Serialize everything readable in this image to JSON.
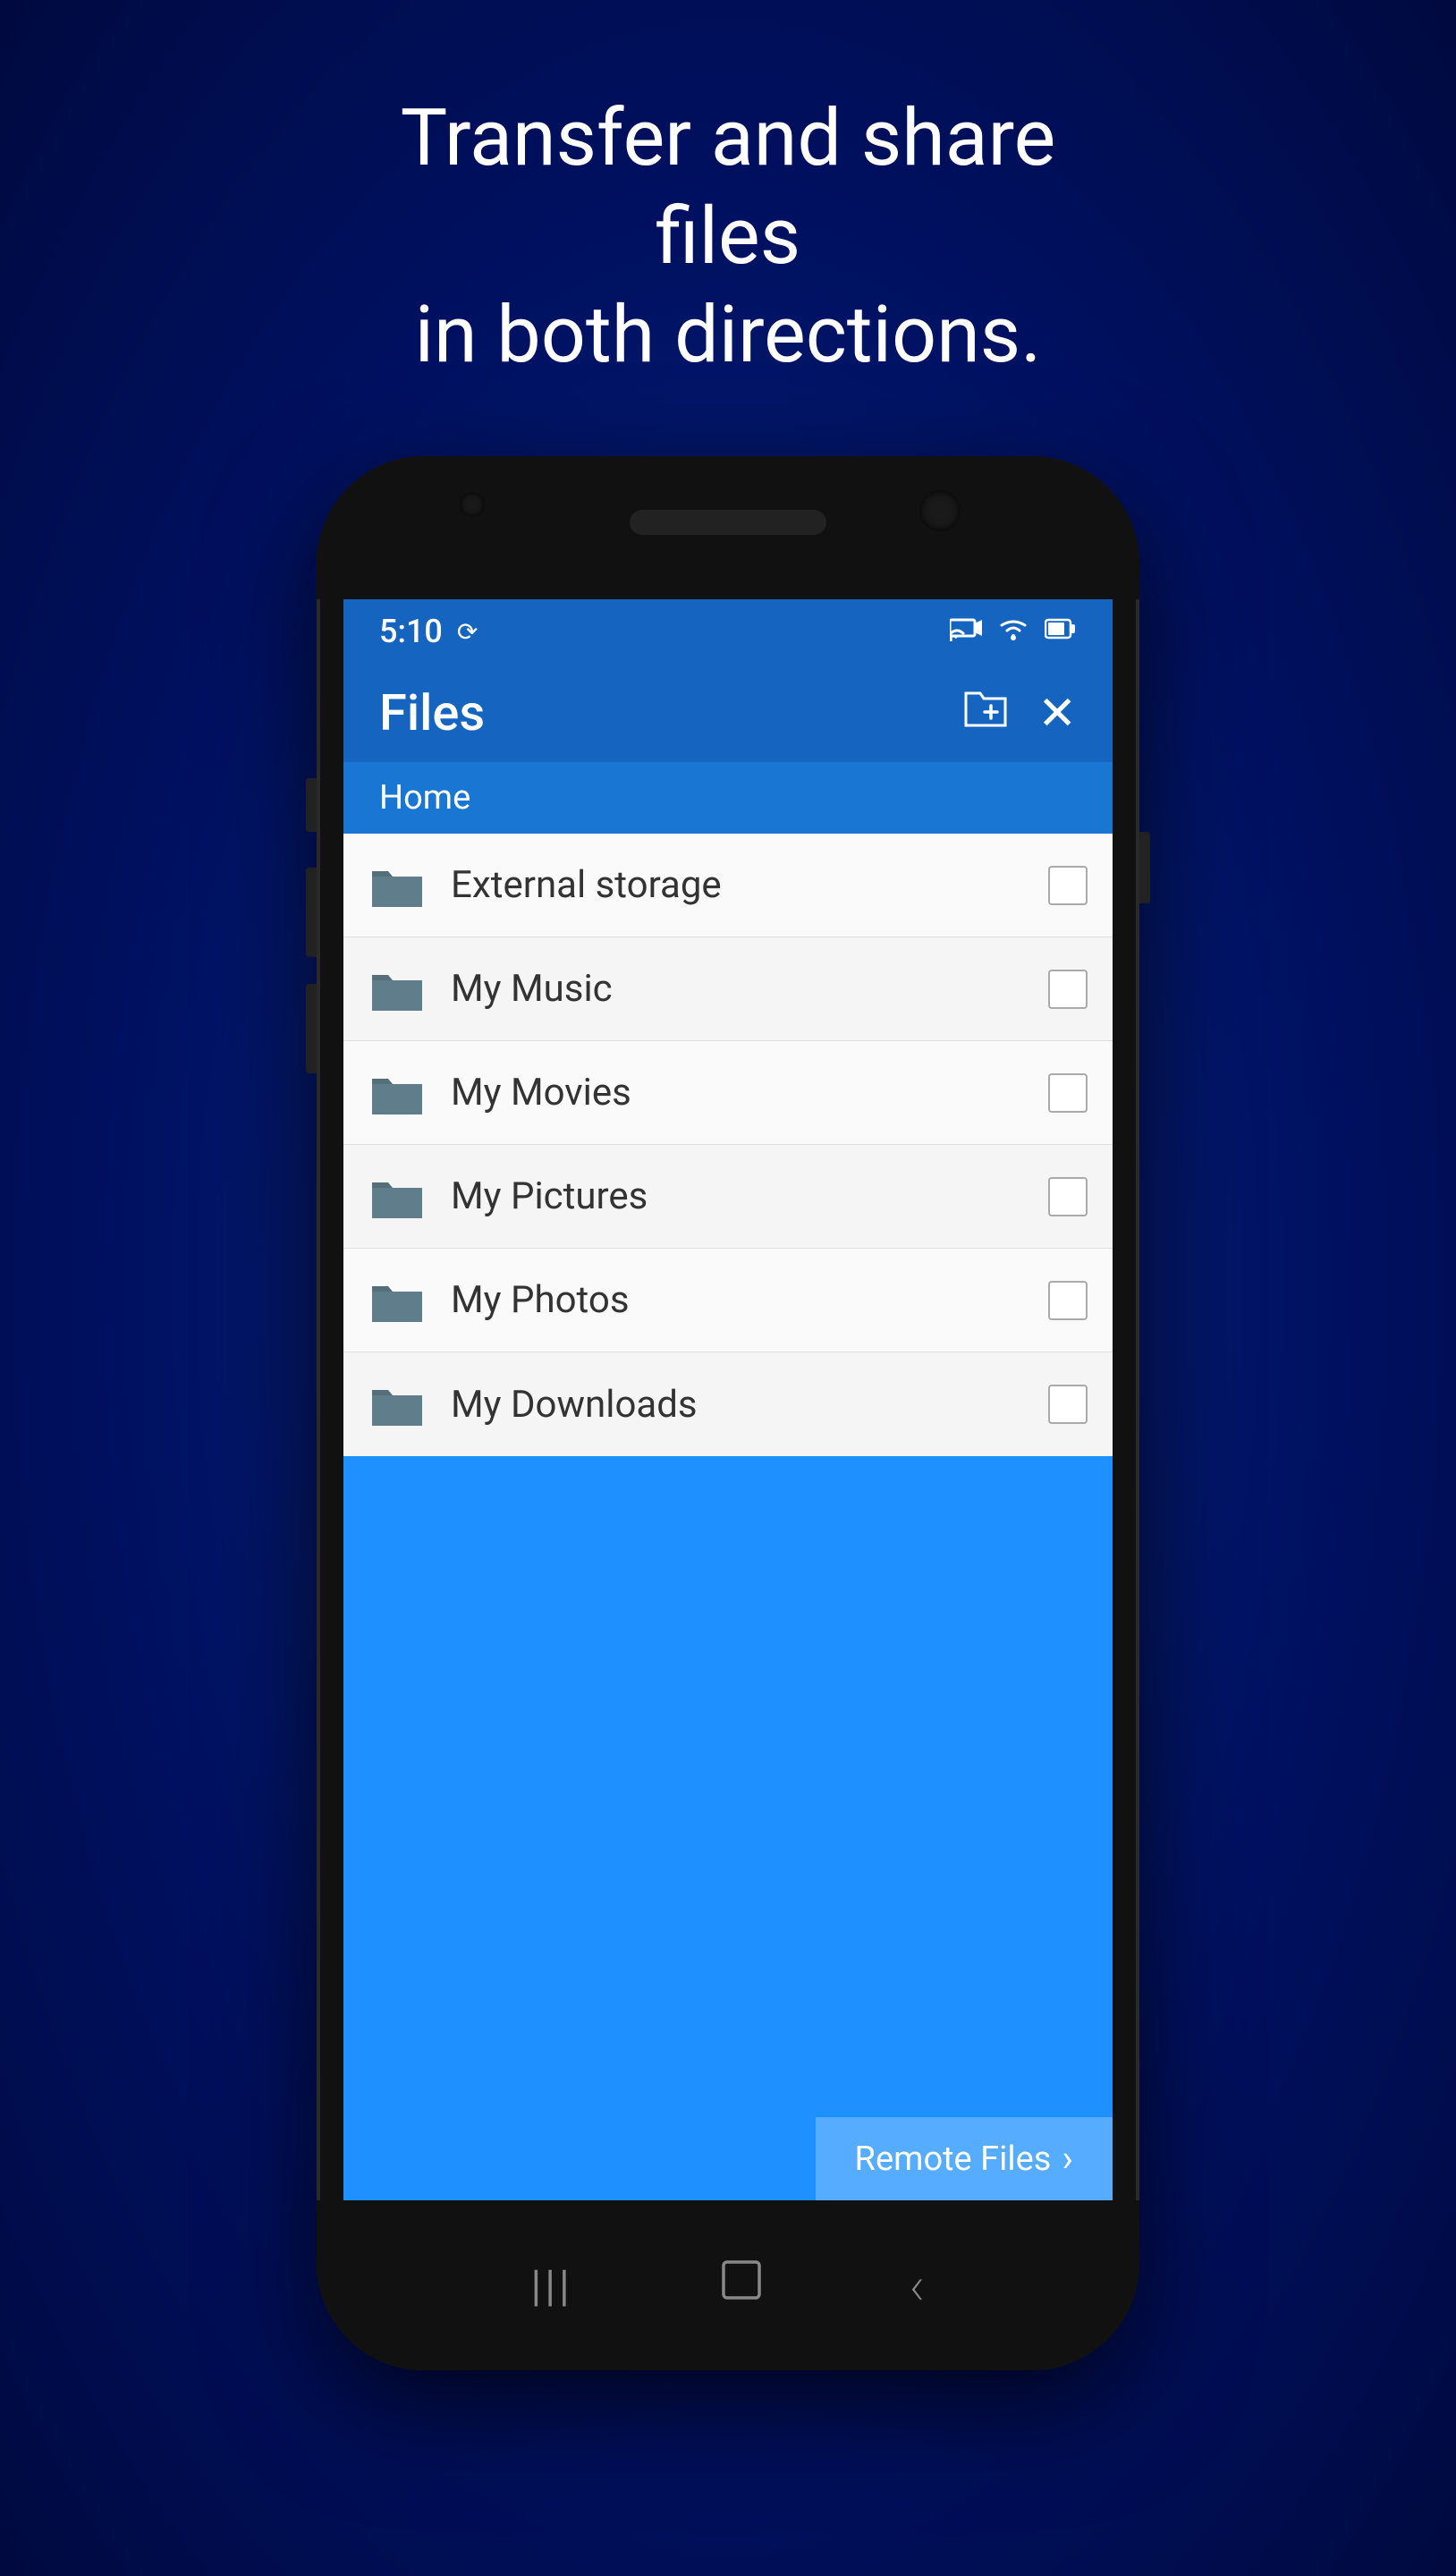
{
  "headline": {
    "line1": "Transfer and share files",
    "line2": "in both directions."
  },
  "status_bar": {
    "time": "5:10",
    "icons": [
      "cast",
      "wifi",
      "battery"
    ]
  },
  "app_header": {
    "title": "Files",
    "add_folder_icon": "📁+",
    "close_icon": "✕"
  },
  "breadcrumb": {
    "path": "Home"
  },
  "file_items": [
    {
      "name": "External storage"
    },
    {
      "name": "My Music"
    },
    {
      "name": "My Movies"
    },
    {
      "name": "My Pictures"
    },
    {
      "name": "My Photos"
    },
    {
      "name": "My Downloads"
    }
  ],
  "remote_files_button": {
    "label": "Remote Files"
  },
  "nav": {
    "menu_icon": "|||",
    "home_icon": "□",
    "back_icon": "‹"
  }
}
